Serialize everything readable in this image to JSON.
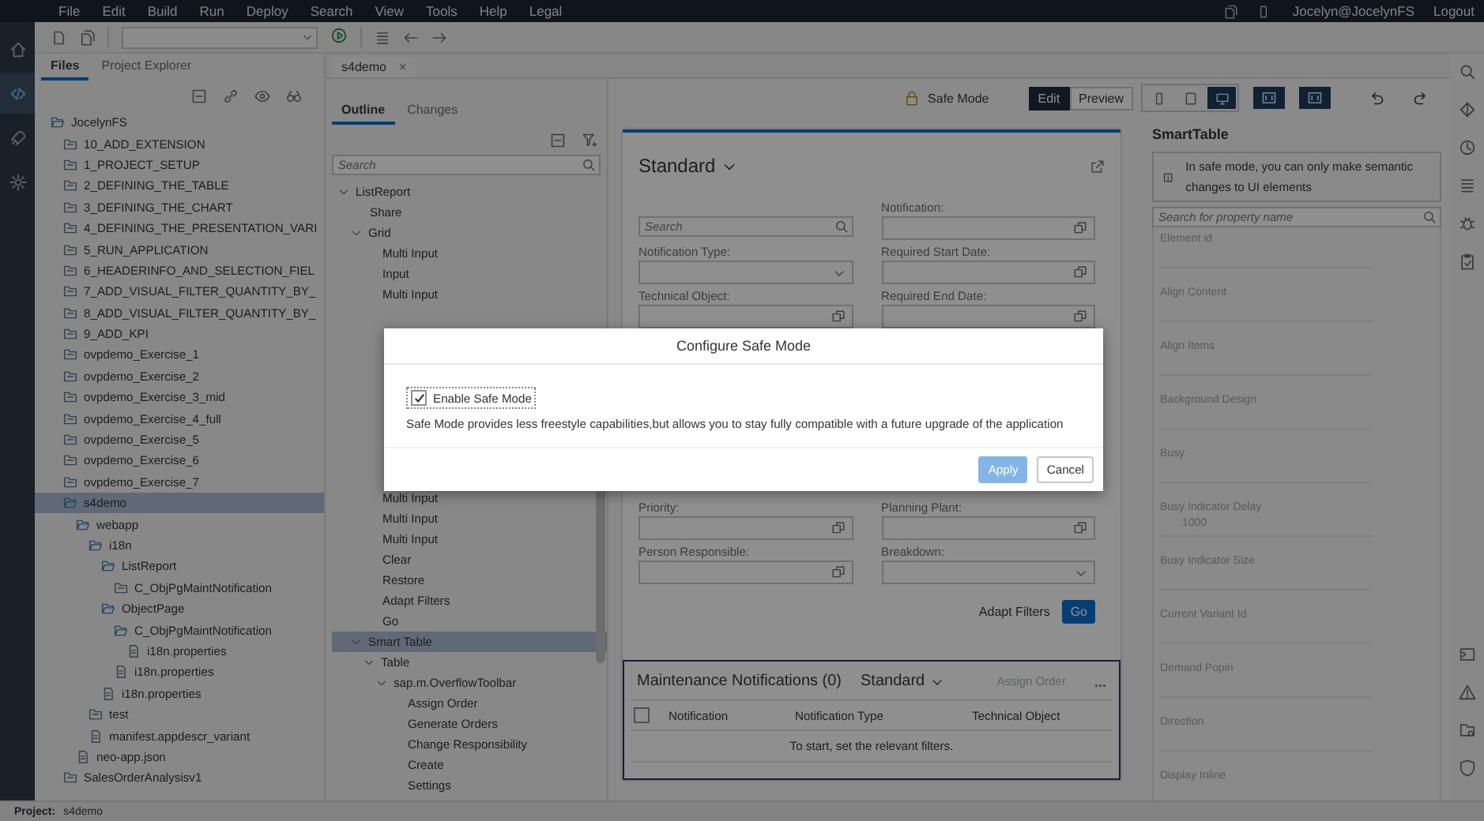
{
  "menu_bar": {
    "items": [
      "File",
      "Edit",
      "Build",
      "Run",
      "Deploy",
      "Search",
      "View",
      "Tools",
      "Help",
      "Legal"
    ],
    "user": "Jocelyn@JocelynFS",
    "logout": "Logout"
  },
  "left_rail": [
    {
      "selected": false
    },
    {
      "selected": true
    },
    {
      "selected": false
    },
    {
      "selected": false
    }
  ],
  "files_panel": {
    "tabs": [
      {
        "label": "Files",
        "selected": true
      },
      {
        "label": "Project Explorer",
        "selected": false
      }
    ],
    "tree": [
      {
        "label": "JocelynFS",
        "kind": "folder",
        "expanded": true,
        "selected": false,
        "children": [
          {
            "label": "10_ADD_EXTENSION",
            "kind": "folder",
            "expanded": false,
            "selected": false
          },
          {
            "label": "1_PROJECT_SETUP",
            "kind": "folder",
            "expanded": false,
            "selected": false
          },
          {
            "label": "2_DEFINING_THE_TABLE",
            "kind": "folder",
            "expanded": false,
            "selected": false
          },
          {
            "label": "3_DEFINING_THE_CHART",
            "kind": "folder",
            "expanded": false,
            "selected": false
          },
          {
            "label": "4_DEFINING_THE_PRESENTATION_VARI",
            "kind": "folder",
            "expanded": false,
            "selected": false
          },
          {
            "label": "5_RUN_APPLICATION",
            "kind": "folder",
            "expanded": false,
            "selected": false
          },
          {
            "label": "6_HEADERINFO_AND_SELECTION_FIEL",
            "kind": "folder",
            "expanded": false,
            "selected": false
          },
          {
            "label": "7_ADD_VISUAL_FILTER_QUANTITY_BY_",
            "kind": "folder",
            "expanded": false,
            "selected": false
          },
          {
            "label": "8_ADD_VISUAL_FILTER_QUANTITY_BY_",
            "kind": "folder",
            "expanded": false,
            "selected": false
          },
          {
            "label": "9_ADD_KPI",
            "kind": "folder",
            "expanded": false,
            "selected": false
          },
          {
            "label": "ovpdemo_Exercise_1",
            "kind": "folder",
            "expanded": false,
            "selected": false
          },
          {
            "label": "ovpdemo_Exercise_2",
            "kind": "folder",
            "expanded": false,
            "selected": false
          },
          {
            "label": "ovpdemo_Exercise_3_mid",
            "kind": "folder",
            "expanded": false,
            "selected": false
          },
          {
            "label": "ovpdemo_Exercise_4_full",
            "kind": "folder",
            "expanded": false,
            "selected": false
          },
          {
            "label": "ovpdemo_Exercise_5",
            "kind": "folder",
            "expanded": false,
            "selected": false
          },
          {
            "label": "ovpdemo_Exercise_6",
            "kind": "folder",
            "expanded": false,
            "selected": false
          },
          {
            "label": "ovpdemo_Exercise_7",
            "kind": "folder",
            "expanded": false,
            "selected": false
          },
          {
            "label": "s4demo",
            "kind": "folder",
            "expanded": true,
            "selected": true,
            "children": [
              {
                "label": "webapp",
                "kind": "folder",
                "expanded": true,
                "selected": false,
                "children": [
                  {
                    "label": "i18n",
                    "kind": "folder",
                    "expanded": true,
                    "selected": false,
                    "children": [
                      {
                        "label": "ListReport",
                        "kind": "folder",
                        "expanded": true,
                        "selected": false,
                        "children": [
                          {
                            "label": "C_ObjPgMaintNotification",
                            "kind": "folder",
                            "expanded": false,
                            "selected": false
                          }
                        ]
                      },
                      {
                        "label": "ObjectPage",
                        "kind": "folder",
                        "expanded": true,
                        "selected": false,
                        "children": [
                          {
                            "label": "C_ObjPgMaintNotification",
                            "kind": "folder",
                            "expanded": true,
                            "selected": false,
                            "children": [
                              {
                                "label": "i18n.properties",
                                "kind": "file",
                                "selected": false
                              }
                            ]
                          },
                          {
                            "label": "i18n.properties",
                            "kind": "file",
                            "selected": false
                          }
                        ]
                      },
                      {
                        "label": "i18n.properties",
                        "kind": "file",
                        "selected": false
                      }
                    ]
                  },
                  {
                    "label": "test",
                    "kind": "folder",
                    "expanded": false,
                    "selected": false
                  },
                  {
                    "label": "manifest.appdescr_variant",
                    "kind": "file",
                    "selected": false
                  }
                ]
              },
              {
                "label": "neo-app.json",
                "kind": "file",
                "selected": false
              }
            ]
          },
          {
            "label": "SalesOrderAnalysisv1",
            "kind": "folder",
            "expanded": false,
            "selected": false
          }
        ]
      }
    ]
  },
  "editor_tab": {
    "label": "s4demo",
    "close": "×"
  },
  "outline_panel": {
    "tabs": [
      {
        "label": "Outline",
        "selected": true
      },
      {
        "label": "Changes",
        "selected": false
      }
    ],
    "search": {
      "placeholder": "Search"
    },
    "tree": [
      {
        "label": "ListReport",
        "expanded": true,
        "selected": false,
        "children": [
          {
            "label": "Share",
            "selected": false
          },
          {
            "label": "Grid",
            "expanded": true,
            "selected": false,
            "children": [
              {
                "label": "Multi Input",
                "selected": false
              },
              {
                "label": "Input",
                "selected": false
              },
              {
                "label": "Multi Input",
                "selected": false
              },
              {
                "label": "Multi Input",
                "selected": false
              },
              {
                "label": "Multi Input",
                "selected": false
              },
              {
                "label": "Multi Input",
                "selected": false
              },
              {
                "label": "Clear",
                "selected": false
              },
              {
                "label": "Restore",
                "selected": false
              },
              {
                "label": "Adapt Filters",
                "selected": false
              },
              {
                "label": "Go",
                "selected": false
              }
            ]
          },
          {
            "label": "Smart Table",
            "expanded": true,
            "selected": true,
            "children": [
              {
                "label": "Table",
                "expanded": true,
                "selected": false,
                "children": [
                  {
                    "label": "sap.m.OverflowToolbar",
                    "expanded": true,
                    "selected": false,
                    "children": [
                      {
                        "label": "Assign Order",
                        "selected": false
                      },
                      {
                        "label": "Generate Orders",
                        "selected": false
                      },
                      {
                        "label": "Change Responsibility",
                        "selected": false
                      },
                      {
                        "label": "Create",
                        "selected": false
                      },
                      {
                        "label": "Settings",
                        "selected": false
                      }
                    ]
                  }
                ]
              }
            ]
          }
        ]
      }
    ]
  },
  "canvas_toolbar": {
    "safe_mode": "Safe Mode",
    "mode_tabs": [
      {
        "label": "Edit",
        "selected": true
      },
      {
        "label": "Preview",
        "selected": false
      }
    ],
    "device_buttons": [
      {
        "selected": false
      },
      {
        "selected": false
      },
      {
        "selected": true
      }
    ],
    "view_buttons": [
      {
        "selected": true
      },
      {
        "selected": true
      }
    ]
  },
  "filter_bar": {
    "variant": "Standard",
    "search": {
      "placeholder": "Search"
    },
    "fields": [
      {
        "kind": "valuehelp",
        "label": "Notification:"
      },
      {
        "kind": "select",
        "label": "Notification Type:"
      },
      {
        "kind": "valuehelp",
        "label": "Required Start Date:"
      },
      {
        "kind": "valuehelp",
        "label": "Technical Object:"
      },
      {
        "kind": "valuehelp",
        "label": "Required End Date:"
      },
      {
        "kind": "valuehelp",
        "label": "Priority:"
      },
      {
        "kind": "valuehelp",
        "label": "Planning Plant:"
      },
      {
        "kind": "valuehelp",
        "label": "Person Responsible:"
      },
      {
        "kind": "select",
        "label": "Breakdown:"
      }
    ],
    "adapt_filters": "Adapt Filters",
    "go": "Go"
  },
  "table": {
    "title": "Maintenance Notifications (0)",
    "variant": "Standard",
    "assign_order": "Assign Order",
    "more": "...",
    "select_all_checked": false,
    "columns": [
      "Notification",
      "Notification Type",
      "Technical Object"
    ],
    "empty_text": "To start, set the relevant filters."
  },
  "properties": {
    "title": "SmartTable",
    "info": "In safe mode, you can only make semantic changes to UI elements",
    "search": {
      "placeholder": "Search for property name"
    },
    "items": [
      {
        "label": "Element id"
      },
      {
        "label": "Align Content"
      },
      {
        "label": "Align Items"
      },
      {
        "label": "Background Design"
      },
      {
        "label": "Busy"
      },
      {
        "label": "Busy Indicator Delay",
        "value": "1000"
      },
      {
        "label": "Busy Indicator Size"
      },
      {
        "label": "Current Variant Id"
      },
      {
        "label": "Demand Popin"
      },
      {
        "label": "Direction"
      },
      {
        "label": "Display Inline"
      }
    ]
  },
  "status_bar": {
    "label": "Project:",
    "value": "s4demo"
  },
  "dialog": {
    "title": "Configure Safe Mode",
    "checkbox": {
      "label": "Enable Safe Mode",
      "checked": true
    },
    "description": "Safe Mode provides less freestyle capabilities,but allows you to stay fully compatible with a future upgrade of the application",
    "buttons": [
      {
        "label": "Apply",
        "kind": "emphasized",
        "disabled": true
      },
      {
        "label": "Cancel",
        "kind": "default",
        "disabled": false
      }
    ]
  }
}
